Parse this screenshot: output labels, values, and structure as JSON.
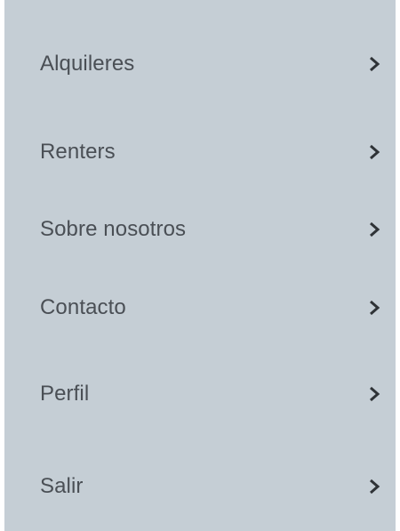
{
  "menu": {
    "items": [
      {
        "label": "Alquileres",
        "icon": "chevron-right-icon"
      },
      {
        "label": "Renters",
        "icon": "chevron-right-icon"
      },
      {
        "label": "Sobre nosotros",
        "icon": "chevron-right-icon"
      },
      {
        "label": "Contacto",
        "icon": "chevron-right-icon"
      },
      {
        "label": "Perfil",
        "icon": "chevron-right-icon"
      },
      {
        "label": "Salir",
        "icon": "chevron-right-icon"
      }
    ]
  },
  "colors": {
    "panel_background": "#c5ced5",
    "label_text": "#4a4f55",
    "chevron": "#2f3337"
  }
}
